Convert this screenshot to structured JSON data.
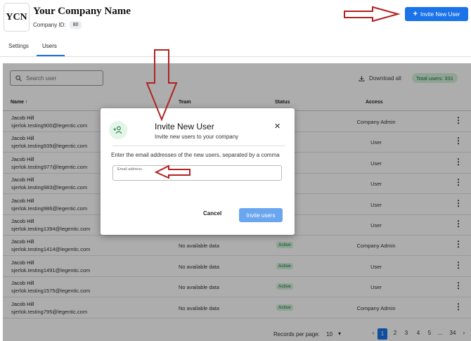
{
  "header": {
    "logo_text": "YCN",
    "company_name": "Your Company Name",
    "company_id_label": "Company ID:",
    "company_id_value": "80",
    "invite_button_label": "Invite New User",
    "accent": "#1a73e8"
  },
  "tabs": [
    {
      "label": "Settings",
      "active": false
    },
    {
      "label": "Users",
      "active": true
    }
  ],
  "toolbar": {
    "search_placeholder": "Search user",
    "download_label": "Download all",
    "total_users": "Total users: 331"
  },
  "table": {
    "columns": [
      "Name",
      "Team",
      "Status",
      "Access"
    ],
    "rows": [
      {
        "name": "Jacob Hill",
        "email": "sjerlok.testing900@legentic.com",
        "team": "",
        "status": "",
        "access": "Company Admin"
      },
      {
        "name": "Jacob Hill",
        "email": "sjerlok.testing939@legentic.com",
        "team": "",
        "status": "",
        "access": "User"
      },
      {
        "name": "Jacob Hill",
        "email": "sjerlok.testing977@legentic.com",
        "team": "",
        "status": "",
        "access": "User"
      },
      {
        "name": "Jacob Hill",
        "email": "sjerlok.testing983@legentic.com",
        "team": "",
        "status": "",
        "access": "User"
      },
      {
        "name": "Jacob Hill",
        "email": "sjerlok.testing986@legentic.com",
        "team": "",
        "status": "",
        "access": "User"
      },
      {
        "name": "Jacob Hill",
        "email": "sjerlok.testing1394@legentic.com",
        "team": "",
        "status": "",
        "access": "User"
      },
      {
        "name": "Jacob Hill",
        "email": "sjerlok.testing1414@legentic.com",
        "team": "No available data",
        "status": "Active",
        "access": "Company Admin"
      },
      {
        "name": "Jacob Hill",
        "email": "sjerlok.testing1491@legentic.com",
        "team": "No available data",
        "status": "Active",
        "access": "User"
      },
      {
        "name": "Jacob Hill",
        "email": "sjerlok.testing1575@legentic.com",
        "team": "No available data",
        "status": "Active",
        "access": "User"
      },
      {
        "name": "Jacob Hill",
        "email": "sjerlok.testing795@legentic.com",
        "team": "No available data",
        "status": "Active",
        "access": "Company Admin"
      }
    ]
  },
  "pagination": {
    "label": "Records per page:",
    "page_size": "10",
    "pages": [
      "1",
      "2",
      "3",
      "4",
      "5",
      "...",
      "34"
    ],
    "current_page": "1"
  },
  "modal": {
    "title": "Invite New User",
    "subtitle": "Invite new users to your company",
    "instruction": "Enter the email addresses of the new users, separated by a comma",
    "email_label": "Email address",
    "email_value": "",
    "cancel_label": "Cancel",
    "submit_label": "Invite users",
    "icon": "person-add-icon"
  },
  "annotation_color": "#b22222"
}
